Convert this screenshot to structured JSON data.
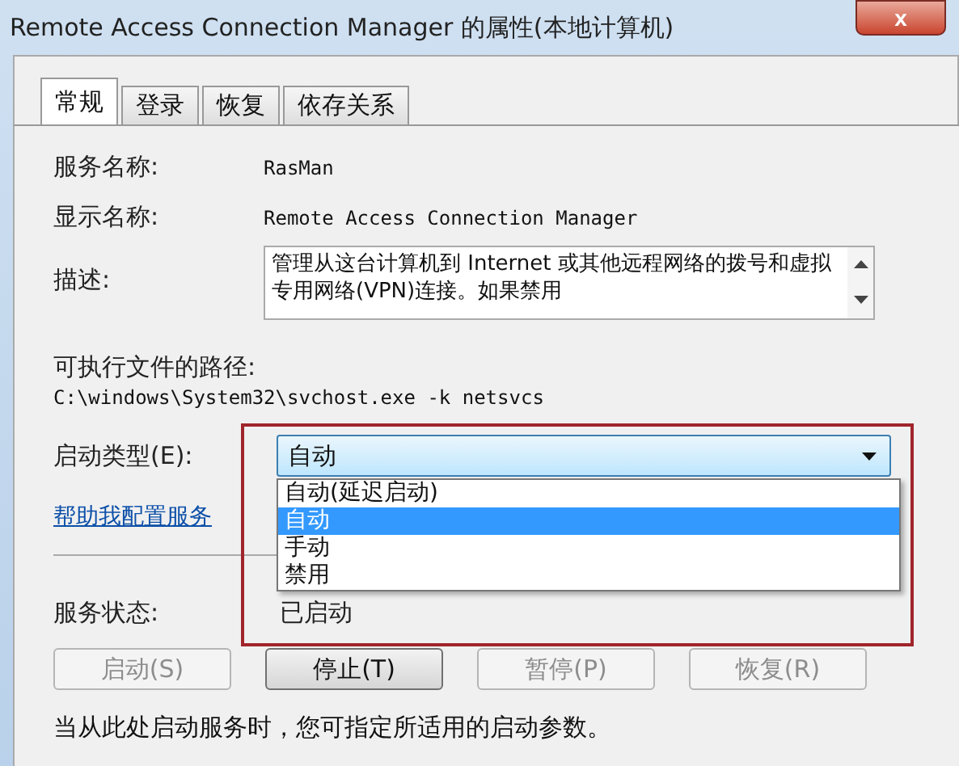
{
  "window": {
    "title": "Remote Access Connection Manager 的属性(本地计算机)",
    "close": "x"
  },
  "tabs": [
    {
      "label": "常规",
      "selected": true
    },
    {
      "label": "登录",
      "selected": false
    },
    {
      "label": "恢复",
      "selected": false
    },
    {
      "label": "依存关系",
      "selected": false
    }
  ],
  "service_name": {
    "label": "服务名称:",
    "value": "RasMan"
  },
  "display_name": {
    "label": "显示名称:",
    "value": "Remote Access Connection Manager"
  },
  "description": {
    "label": "描述:",
    "value": "管理从这台计算机到 Internet 或其他远程网络的拨号和虚拟专用网络(VPN)连接。如果禁用"
  },
  "path": {
    "label": "可执行文件的路径:",
    "value": "C:\\windows\\System32\\svchost.exe -k netsvcs"
  },
  "startup_type": {
    "label": "启动类型(E):",
    "value": "自动",
    "expanded": true,
    "options": [
      {
        "label": "自动(延迟启动)",
        "selected": false
      },
      {
        "label": "自动",
        "selected": true
      },
      {
        "label": "手动",
        "selected": false
      },
      {
        "label": "禁用",
        "selected": false
      }
    ]
  },
  "help_link": "帮助我配置服务",
  "service_status": {
    "label": "服务状态:",
    "value": "已启动"
  },
  "buttons": [
    {
      "label": "启动(S)",
      "disabled": true
    },
    {
      "label": "停止(T)",
      "disabled": false
    },
    {
      "label": "暂停(P)",
      "disabled": true
    },
    {
      "label": "恢复(R)",
      "disabled": true
    }
  ],
  "hint": "当从此处启动服务时，您可指定所适用的启动参数。"
}
